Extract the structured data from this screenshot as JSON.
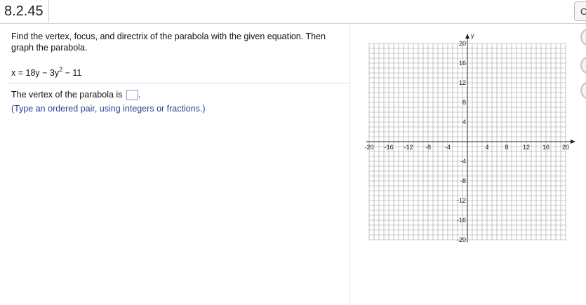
{
  "header": {
    "problem_id": "8.2.45",
    "tab_peek_label": "C"
  },
  "question": {
    "instruction": "Find the vertex, focus, and directrix of the parabola with the given equation. Then graph the parabola.",
    "equation_pre": "x = 18y − 3y",
    "equation_exp": "2",
    "equation_post": " − 11",
    "vertex_prompt": "The vertex of the parabola is",
    "vertex_prompt_end": ".",
    "vertex_answer": "",
    "hint": "(Type an ordered pair, using integers or fractions.)"
  },
  "graph": {
    "x_axis_label": "x",
    "y_axis_label": "y",
    "x_ticks": [
      "-20",
      "-16",
      "-12",
      "-8",
      "-4",
      "4",
      "8",
      "12",
      "16",
      "20"
    ],
    "y_ticks": [
      "20",
      "16",
      "12",
      "8",
      "4",
      "-4",
      "-8",
      "-12",
      "-16",
      "-20"
    ]
  }
}
